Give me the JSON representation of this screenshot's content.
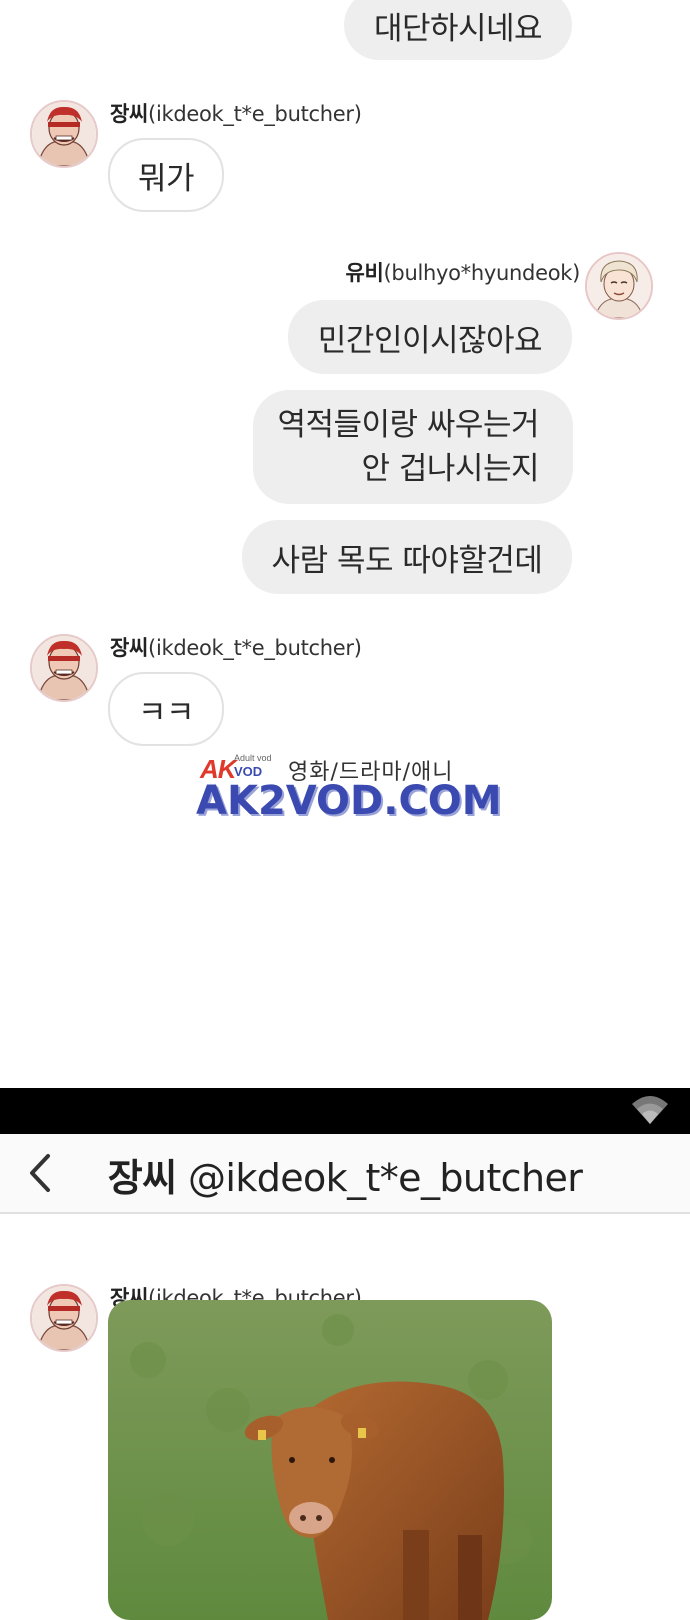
{
  "thread": {
    "messages": [
      {
        "from": "me",
        "text": "대단하시네요"
      },
      {
        "from": "other",
        "sender_name": "장씨",
        "sender_handle": "(ikdeok_t*e_butcher)",
        "text": "뭐가"
      },
      {
        "from": "me",
        "sender_name": "유비",
        "sender_handle": "(bulhyo*hyundeok)",
        "text": "민간인이시잖아요"
      },
      {
        "from": "me",
        "lines": [
          "역적들이랑 싸우는거",
          "안 겁나시는지"
        ]
      },
      {
        "from": "me",
        "text": "사람 목도 따야할건데"
      },
      {
        "from": "other",
        "sender_name": "장씨",
        "sender_handle": "(ikdeok_t*e_butcher)",
        "text": "ㅋㅋ"
      }
    ]
  },
  "watermark": {
    "logo_big": "AK",
    "logo_vod": "VOD",
    "logo_small": "Adult vod",
    "tagline": "영화/드라마/애니",
    "site": "AK2VOD.COM"
  },
  "status_bar": {
    "icon": "wifi-icon"
  },
  "chat_header": {
    "name": "장씨",
    "handle": "@ikdeok_t*e_butcher",
    "back_icon": "chevron-left-icon"
  },
  "thread2": {
    "sender_name": "장씨",
    "sender_handle": "(ikdeok_t*e_butcher)",
    "image_subject": "bull in grass field"
  },
  "colors": {
    "outgoing_bubble": "#eeeeee",
    "incoming_border": "#e2e2e2",
    "watermark_blue": "#3b4ab0",
    "watermark_red": "#e0382a",
    "status_bar": "#000000"
  }
}
